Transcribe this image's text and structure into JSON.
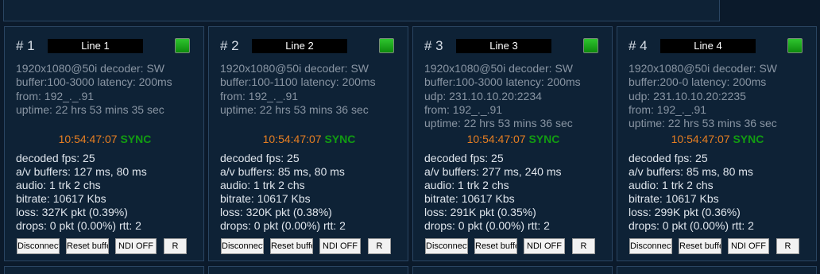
{
  "colors": {
    "background": "#0b1a2b",
    "panel": "#0e2236",
    "border": "#2a4562",
    "time": "#e67e22",
    "sync": "#129c12",
    "led": "#1fb01f"
  },
  "cards": [
    {
      "number": "# 1",
      "name": "Line 1",
      "info": [
        "1920x1080@50i decoder: SW",
        "buffer:100-3000 latency: 200ms",
        "from: 192_._.91",
        "uptime: 22 hrs 53 mins 35 sec"
      ],
      "time": "10:54:47:07",
      "sync": "SYNC",
      "stats": [
        "decoded fps: 25",
        "a/v buffers: 127 ms, 80 ms",
        "audio: 1 trk 2 chs",
        "bitrate: 10617 Kbs",
        "loss: 327K pkt (0.39%)",
        "drops: 0 pkt (0.00%) rtt: 2"
      ],
      "buttons": [
        "Disconnect",
        "Reset buffe",
        "NDI OFF",
        "R"
      ]
    },
    {
      "number": "# 2",
      "name": "Line 2",
      "info": [
        "1920x1080@50i decoder: SW",
        "buffer:100-1100 latency: 200ms",
        "from: 192_._.91",
        "uptime: 22 hrs 53 mins 36 sec"
      ],
      "time": "10:54:47:07",
      "sync": "SYNC",
      "stats": [
        "decoded fps: 25",
        "a/v buffers: 85 ms, 80 ms",
        "audio: 1 trk 2 chs",
        "bitrate: 10617 Kbs",
        "loss: 320K pkt (0.38%)",
        "drops: 0 pkt (0.00%) rtt: 2"
      ],
      "buttons": [
        "Disconnect",
        "Reset buffe",
        "NDI OFF",
        "R"
      ]
    },
    {
      "number": "# 3",
      "name": "Line 3",
      "info": [
        "1920x1080@50i decoder: SW",
        "buffer:100-3000 latency: 200ms",
        "udp: 231.10.10.20:2234",
        "from: 192_._.91",
        "uptime: 22 hrs 53 mins 36 sec"
      ],
      "time": "10:54:47:07",
      "sync": "SYNC",
      "stats": [
        "decoded fps: 25",
        "a/v buffers: 277 ms, 240 ms",
        "audio: 1 trk 2 chs",
        "bitrate: 10617 Kbs",
        "loss: 291K pkt (0.35%)",
        "drops: 0 pkt (0.00%) rtt: 2"
      ],
      "buttons": [
        "Disconnect",
        "Reset buffe",
        "NDI OFF",
        "R"
      ]
    },
    {
      "number": "# 4",
      "name": "Line 4",
      "info": [
        "1920x1080@50i decoder: SW",
        "buffer:200-0 latency: 200ms",
        "udp: 231.10.10.20:2235",
        "from: 192_._.91",
        "uptime: 22 hrs 53 mins 36 sec"
      ],
      "time": "10:54:47:07",
      "sync": "SYNC",
      "stats": [
        "decoded fps: 25",
        "a/v buffers: 85 ms, 80 ms",
        "audio: 1 trk 2 chs",
        "bitrate: 10617 Kbs",
        "loss: 299K pkt (0.36%)",
        "drops: 0 pkt (0.00%) rtt: 2"
      ],
      "buttons": [
        "Disconnect",
        "Reset buffe",
        "NDI OFF",
        "R"
      ]
    }
  ]
}
